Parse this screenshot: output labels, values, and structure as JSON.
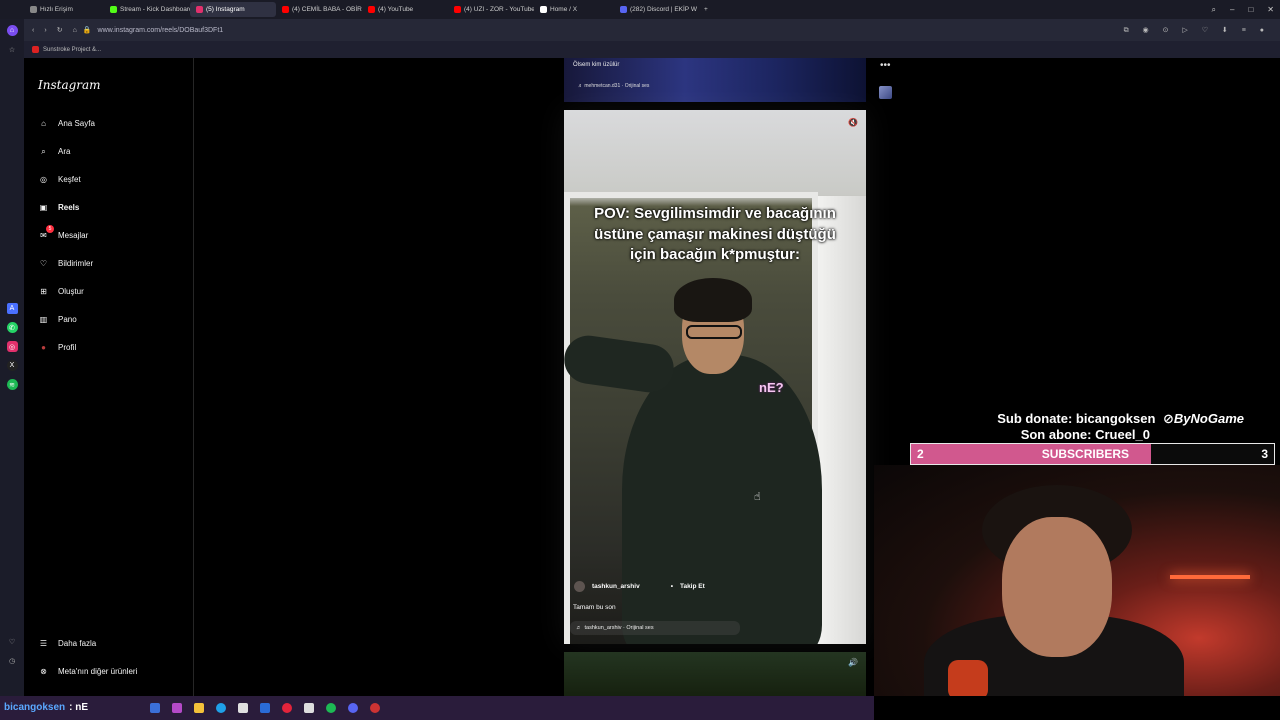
{
  "browser": {
    "tabs": [
      {
        "label": "Hızlı Erişim",
        "color": "#888888"
      },
      {
        "label": "Stream - Kick Dashboard",
        "color": "#53fc18"
      },
      {
        "label": "(5) Instagram",
        "color": "#e1306c"
      },
      {
        "label": "(4) CEMİL BABA - OBİR STİ",
        "color": "#ff0000"
      },
      {
        "label": "(4) YouTube",
        "color": "#ff0000"
      },
      {
        "label": "(4) UZI - ZOR - YouTube",
        "color": "#ff0000"
      },
      {
        "label": "Home / X",
        "color": "#ffffff"
      },
      {
        "label": "(282) Discord | EKİP W",
        "color": "#5865f2"
      }
    ],
    "new_tab": "+",
    "url": "www.instagram.com/reels/DOBauf3DFt1",
    "bookmark": "Sunstroke Project &..."
  },
  "instagram": {
    "logo": "Instagram",
    "nav": [
      {
        "label": "Ana Sayfa",
        "icon": "home-icon",
        "glyph": "⌂"
      },
      {
        "label": "Ara",
        "icon": "search-icon",
        "glyph": "⌕"
      },
      {
        "label": "Keşfet",
        "icon": "compass-icon",
        "glyph": "◎"
      },
      {
        "label": "Reels",
        "icon": "reels-icon",
        "glyph": "▣"
      },
      {
        "label": "Mesajlar",
        "icon": "messenger-icon",
        "glyph": "✉",
        "badge": "5"
      },
      {
        "label": "Bildirimler",
        "icon": "heart-icon",
        "glyph": "♡"
      },
      {
        "label": "Oluştur",
        "icon": "create-icon",
        "glyph": "⊞"
      },
      {
        "label": "Pano",
        "icon": "dashboard-icon",
        "glyph": "▥"
      },
      {
        "label": "Profil",
        "icon": "profile-avatar",
        "glyph": "●"
      }
    ],
    "more": "Daha fazla",
    "meta": "Meta'nın diğer ürünleri"
  },
  "reels": {
    "previous": {
      "caption": "Ölsem kim üzülür",
      "audio": "mehmetcan.d31 · Orijinal ses"
    },
    "current": {
      "overlay": "POV: Sevgilimsimdir ve bacağının üstüne çamaşır makinesi düştüğü için bacağın k*pmuştur:",
      "sticker": "nE?",
      "username": "tashkun_arshiv",
      "follow": "Takip Et",
      "caption": "Tamam bu son",
      "audio": "tashkun_arshiv · Orijinal ses"
    }
  },
  "stream": {
    "sub_donate": "Sub donate: bicangoksen",
    "brand": "ByNoGame",
    "last_sub": "Son abone: Crueel_0",
    "subs": {
      "current": "2",
      "label": "SUBSCRIBERS",
      "goal": "3",
      "progress": 0.66,
      "fill_color": "#d1588e"
    },
    "chat": {
      "name": "bicangoksen",
      "message": ": nE"
    }
  }
}
